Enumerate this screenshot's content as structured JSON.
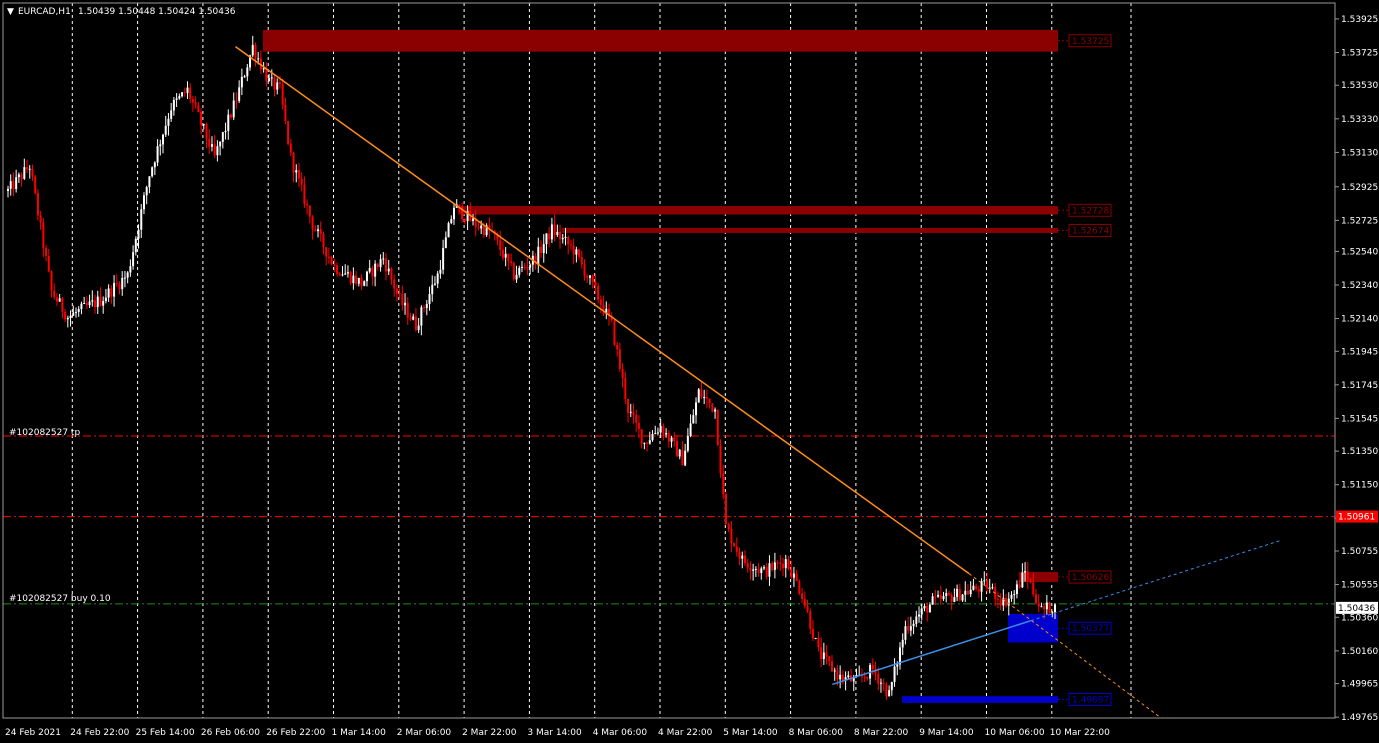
{
  "header": {
    "symbol_tf": "EURCAD,H1",
    "ohlc": "1.50439 1.50448 1.50424 1.50436"
  },
  "order_labels": {
    "tp": "#102082527 tp",
    "buy": "#102082527 buy 0.10"
  },
  "colors": {
    "background": "#000000",
    "bull": "#ffffff",
    "bear": "#ff0000",
    "grid": "#ffffff",
    "supply": "#8b0000",
    "demand": "#0000cd",
    "trend_down": "#ff8c1a",
    "trend_up": "#3a8ee6",
    "tp_line": "#ff0000",
    "buy_line": "#1e8c1e"
  },
  "chart_data": {
    "type": "candlestick",
    "ylim": [
      1.4976,
      1.5402
    ],
    "y_ticks": [
      "1.53925",
      "1.53725",
      "1.53530",
      "1.53330",
      "1.53130",
      "1.52925",
      "1.52725",
      "1.52540",
      "1.52340",
      "1.52140",
      "1.51945",
      "1.51745",
      "1.51545",
      "1.51350",
      "1.51150",
      "1.50950",
      "1.50755",
      "1.50555",
      "1.50360",
      "1.50160",
      "1.49965",
      "1.49765"
    ],
    "x_labels": [
      "24 Feb 2021",
      "24 Feb 22:00",
      "25 Feb 14:00",
      "26 Feb 06:00",
      "26 Feb 22:00",
      "1 Mar 14:00",
      "2 Mar 06:00",
      "2 Mar 22:00",
      "3 Mar 14:00",
      "4 Mar 06:00",
      "4 Mar 22:00",
      "5 Mar 14:00",
      "8 Mar 06:00",
      "8 Mar 22:00",
      "9 Mar 14:00",
      "10 Mar 06:00",
      "10 Mar 22:00"
    ],
    "current_price": "1.50436",
    "tp_price": "1.50961",
    "tp_value": 1.5096,
    "buy_value": 1.5044,
    "tp2_value": 1.5144,
    "zones": [
      {
        "kind": "supply",
        "from": 1.5373,
        "to": 1.5386,
        "label": "1.53725"
      },
      {
        "kind": "supply",
        "from": 1.5276,
        "to": 1.5281,
        "label": "1.52728"
      },
      {
        "kind": "supply",
        "from": 1.5265,
        "to": 1.5268,
        "label": "1.52674"
      },
      {
        "kind": "supply",
        "from": 1.5057,
        "to": 1.5063,
        "label": "1.50626"
      },
      {
        "kind": "demand",
        "from": 1.5021,
        "to": 1.5038,
        "label": "1.50377"
      },
      {
        "kind": "demand",
        "from": 1.4985,
        "to": 1.4989,
        "label": "1.49897"
      }
    ],
    "trendlines": [
      {
        "kind": "down",
        "x1": 0.1745,
        "y1": 1.5376,
        "x2": 0.7253,
        "y2": 1.5062
      },
      {
        "kind": "down-ext",
        "x1": 0.7253,
        "y1": 1.5062,
        "x2": 0.8694,
        "y2": 1.4976
      },
      {
        "kind": "up",
        "x1": 0.6226,
        "y1": 1.4996,
        "x2": 0.7717,
        "y2": 1.5034
      },
      {
        "kind": "up-ext",
        "x1": 0.7717,
        "y1": 1.5034,
        "x2": 0.96,
        "y2": 1.5082
      }
    ],
    "anchors": [
      [
        0,
        1.529
      ],
      [
        8,
        1.5305
      ],
      [
        16,
        1.523
      ],
      [
        22,
        1.5215
      ],
      [
        34,
        1.5225
      ],
      [
        44,
        1.524
      ],
      [
        52,
        1.53
      ],
      [
        60,
        1.534
      ],
      [
        66,
        1.535
      ],
      [
        76,
        1.531
      ],
      [
        84,
        1.5345
      ],
      [
        90,
        1.5376
      ],
      [
        96,
        1.5355
      ],
      [
        100,
        1.535
      ],
      [
        104,
        1.531
      ],
      [
        112,
        1.527
      ],
      [
        120,
        1.5245
      ],
      [
        130,
        1.5235
      ],
      [
        138,
        1.525
      ],
      [
        144,
        1.5225
      ],
      [
        150,
        1.521
      ],
      [
        158,
        1.524
      ],
      [
        164,
        1.5281
      ],
      [
        172,
        1.527
      ],
      [
        178,
        1.5265
      ],
      [
        186,
        1.524
      ],
      [
        194,
        1.525
      ],
      [
        200,
        1.5267
      ],
      [
        208,
        1.5255
      ],
      [
        216,
        1.523
      ],
      [
        222,
        1.521
      ],
      [
        228,
        1.516
      ],
      [
        234,
        1.514
      ],
      [
        240,
        1.515
      ],
      [
        248,
        1.513
      ],
      [
        254,
        1.517
      ],
      [
        260,
        1.516
      ],
      [
        264,
        1.509
      ],
      [
        270,
        1.507
      ],
      [
        278,
        1.5063
      ],
      [
        286,
        1.507
      ],
      [
        292,
        1.505
      ],
      [
        298,
        1.5015
      ],
      [
        306,
        1.5
      ],
      [
        312,
        1.4998
      ],
      [
        318,
        1.5005
      ],
      [
        324,
        1.499
      ],
      [
        330,
        1.503
      ],
      [
        340,
        1.5045
      ],
      [
        350,
        1.505
      ],
      [
        360,
        1.5055
      ],
      [
        366,
        1.5045
      ],
      [
        370,
        1.505
      ],
      [
        374,
        1.5063
      ],
      [
        380,
        1.504
      ],
      [
        385,
        1.5043
      ]
    ]
  }
}
